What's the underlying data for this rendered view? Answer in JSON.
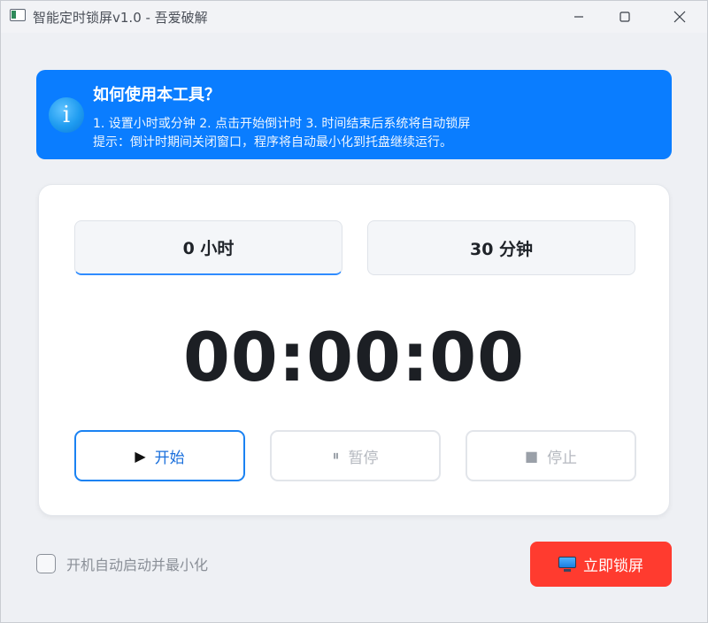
{
  "window": {
    "title": "智能定时锁屏v1.0 - 吾爱破解",
    "minimize_icon": "minimize-icon",
    "maximize_icon": "maximize-icon",
    "close_icon": "close-icon"
  },
  "banner": {
    "icon": "info-icon",
    "icon_glyph": "i",
    "title": "如何使用本工具？",
    "line1": "1. 设置小时或分钟  2. 点击开始倒计时  3. 时间结束后系统将自动锁屏",
    "line2": "提示：倒计时期间关闭窗口，程序将自动最小化到托盘继续运行。",
    "color": "#0a7dff"
  },
  "timer": {
    "hours_value": "0 小时",
    "minutes_value": "30 分钟",
    "countdown": "00:00:00"
  },
  "controls": {
    "start_label": "开始",
    "start_glyph": "▶",
    "pause_label": "暂停",
    "pause_glyph": "⏸",
    "stop_label": "停止",
    "stop_glyph": "■"
  },
  "footer": {
    "autostart_label": "开机自动启动并最小化",
    "autostart_checked": false,
    "lock_now_label": "立即锁屏",
    "lock_icon": "monitor-icon",
    "lock_color": "#ff3b2f"
  }
}
